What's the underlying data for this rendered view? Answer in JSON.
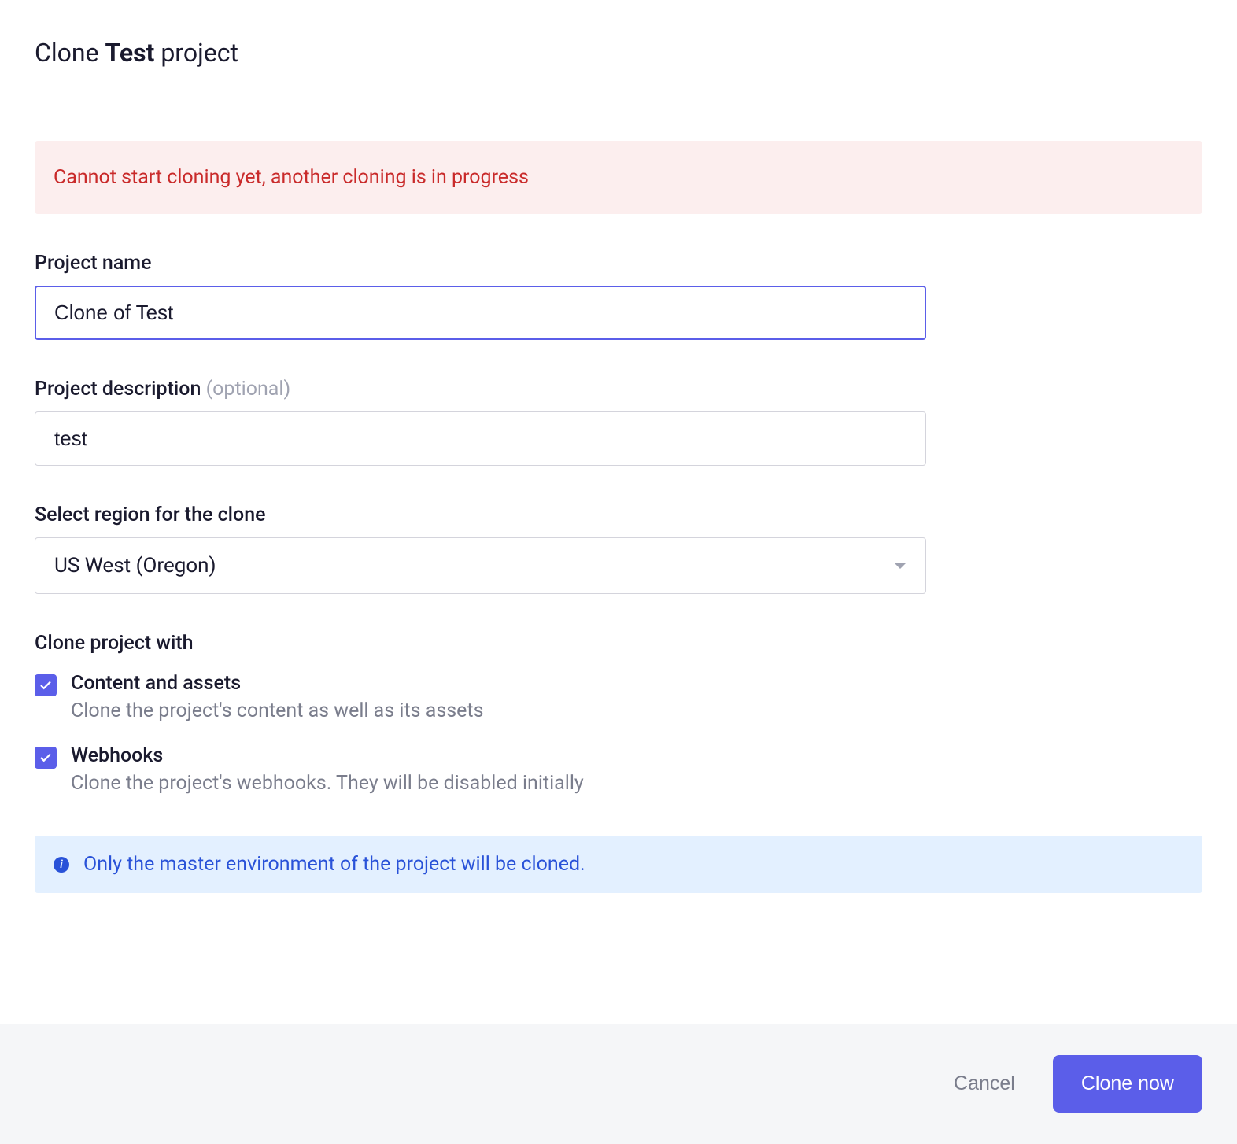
{
  "header": {
    "title_prefix": "Clone ",
    "title_bold": "Test",
    "title_suffix": " project"
  },
  "alert_error": {
    "message": "Cannot start cloning yet, another cloning is in progress"
  },
  "form": {
    "project_name": {
      "label": "Project name",
      "value": "Clone of Test"
    },
    "project_description": {
      "label": "Project description ",
      "optional": "(optional)",
      "value": "test"
    },
    "region": {
      "label": "Select region for the clone",
      "value": "US West (Oregon)"
    },
    "clone_with": {
      "label": "Clone project with",
      "options": [
        {
          "title": "Content and assets",
          "description": "Clone the project's content as well as its assets",
          "checked": true
        },
        {
          "title": "Webhooks",
          "description": "Clone the project's webhooks. They will be disabled initially",
          "checked": true
        }
      ]
    }
  },
  "alert_info": {
    "message": "Only the master environment of the project will be cloned."
  },
  "footer": {
    "cancel_label": "Cancel",
    "submit_label": "Clone now"
  }
}
